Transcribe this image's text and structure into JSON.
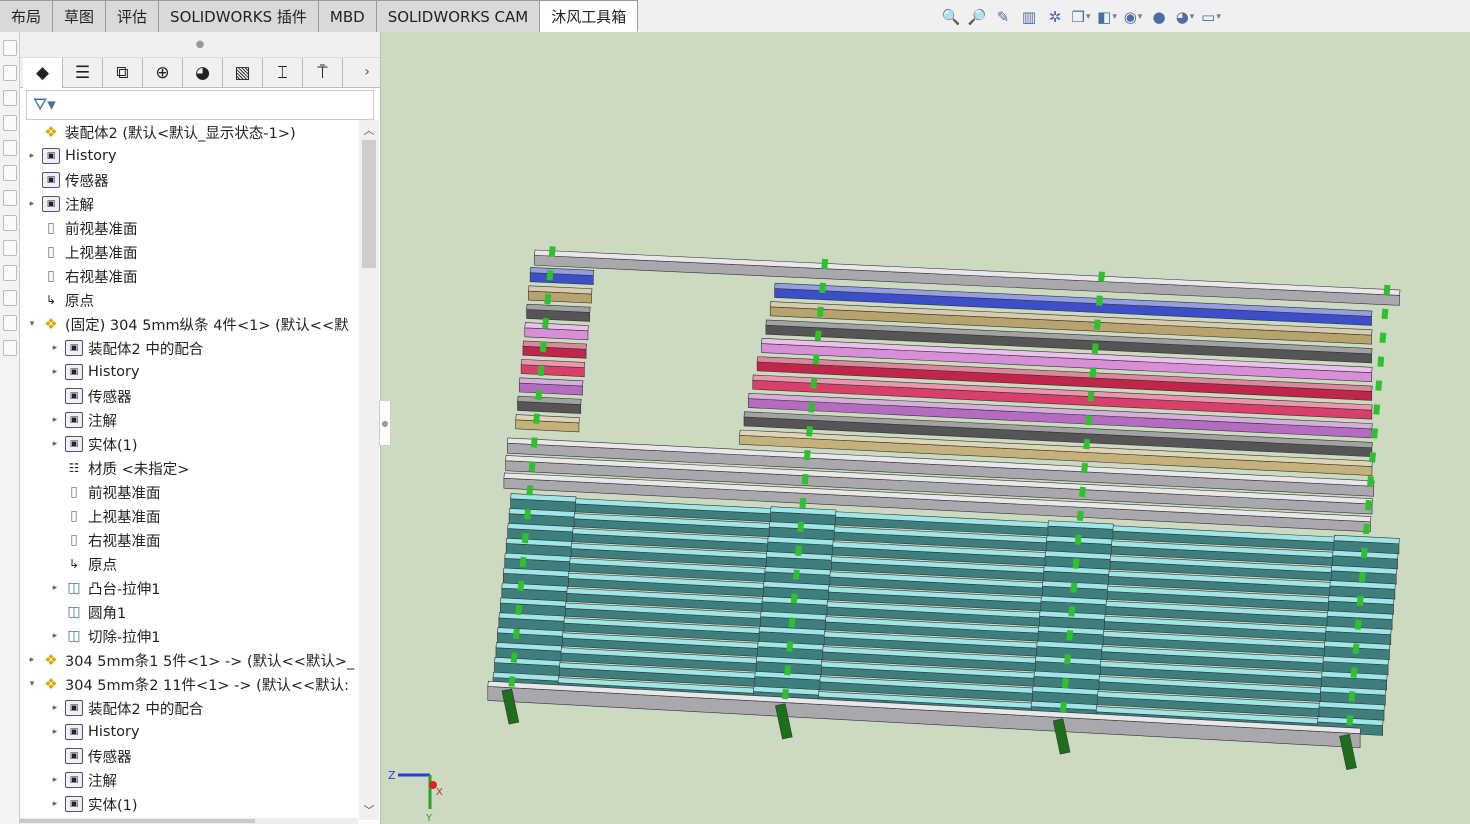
{
  "tabs": [
    {
      "label": "布局"
    },
    {
      "label": "草图"
    },
    {
      "label": "评估"
    },
    {
      "label": "SOLIDWORKS 插件"
    },
    {
      "label": "MBD"
    },
    {
      "label": "SOLIDWORKS CAM"
    },
    {
      "label": "沐风工具箱",
      "active": true
    }
  ],
  "view_tools": [
    {
      "icon": "zoom-to-fit-icon",
      "g": "🔍"
    },
    {
      "icon": "zoom-area-icon",
      "g": "🔎"
    },
    {
      "icon": "previous-view-icon",
      "g": "✎"
    },
    {
      "icon": "section-view-icon",
      "g": "▥"
    },
    {
      "icon": "dynamic-annotation-icon",
      "g": "✲"
    },
    {
      "icon": "view-orientation-icon",
      "g": "❒",
      "dd": true
    },
    {
      "icon": "display-style-icon",
      "g": "◧",
      "dd": true
    },
    {
      "icon": "hide-show-icon",
      "g": "◉",
      "dd": true
    },
    {
      "icon": "edit-appearance-icon",
      "g": "●"
    },
    {
      "icon": "apply-scene-icon",
      "g": "◕",
      "dd": true
    },
    {
      "icon": "view-settings-icon",
      "g": "▭",
      "dd": true
    }
  ],
  "panel_tabs": [
    {
      "icon": "featuremanager-icon",
      "g": "◆",
      "active": true
    },
    {
      "icon": "propertymanager-icon",
      "g": "☰"
    },
    {
      "icon": "configurationmanager-icon",
      "g": "⧉"
    },
    {
      "icon": "dimxpertmanager-icon",
      "g": "⊕"
    },
    {
      "icon": "displaymanager-icon",
      "g": "◕"
    },
    {
      "icon": "cam-feature-tree-icon",
      "g": "▧"
    },
    {
      "icon": "cam-operation-tree-icon",
      "g": "⌶"
    },
    {
      "icon": "cam-tool-tree-icon",
      "g": "⍑"
    }
  ],
  "tree": [
    {
      "label": "装配体2  (默认<默认_显示状态-1>)",
      "level": 0,
      "exp": "",
      "icon": "asm"
    },
    {
      "label": "History",
      "level": 0,
      "exp": "▸",
      "icon": "fold"
    },
    {
      "label": "传感器",
      "level": 0,
      "exp": "",
      "icon": "fold"
    },
    {
      "label": "注解",
      "level": 0,
      "exp": "▸",
      "icon": "fold"
    },
    {
      "label": "前视基准面",
      "level": 0,
      "exp": "",
      "icon": "plane"
    },
    {
      "label": "上视基准面",
      "level": 0,
      "exp": "",
      "icon": "plane"
    },
    {
      "label": "右视基准面",
      "level": 0,
      "exp": "",
      "icon": "plane"
    },
    {
      "label": "原点",
      "level": 0,
      "exp": "",
      "icon": "origin"
    },
    {
      "label": "(固定) 304  5mm纵条   4件<1> (默认<<默",
      "level": 0,
      "exp": "▾",
      "icon": "asm"
    },
    {
      "label": "装配体2 中的配合",
      "level": 1,
      "exp": "▸",
      "icon": "fold"
    },
    {
      "label": "History",
      "level": 1,
      "exp": "▸",
      "icon": "fold"
    },
    {
      "label": "传感器",
      "level": 1,
      "exp": "",
      "icon": "fold"
    },
    {
      "label": "注解",
      "level": 1,
      "exp": "▸",
      "icon": "fold"
    },
    {
      "label": "实体(1)",
      "level": 1,
      "exp": "▸",
      "icon": "fold"
    },
    {
      "label": "材质 <未指定>",
      "level": 1,
      "exp": "",
      "icon": "material"
    },
    {
      "label": "前视基准面",
      "level": 1,
      "exp": "",
      "icon": "plane"
    },
    {
      "label": "上视基准面",
      "level": 1,
      "exp": "",
      "icon": "plane"
    },
    {
      "label": "右视基准面",
      "level": 1,
      "exp": "",
      "icon": "plane"
    },
    {
      "label": "原点",
      "level": 1,
      "exp": "",
      "icon": "origin"
    },
    {
      "label": "凸台-拉伸1",
      "level": 1,
      "exp": "▸",
      "icon": "feat"
    },
    {
      "label": "圆角1",
      "level": 1,
      "exp": "",
      "icon": "feat"
    },
    {
      "label": "切除-拉伸1",
      "level": 1,
      "exp": "▸",
      "icon": "feat"
    },
    {
      "label": "304  5mm条1  5件<1> -> (默认<<默认>_",
      "level": 0,
      "exp": "▸",
      "icon": "asm"
    },
    {
      "label": "304  5mm条2   11件<1> -> (默认<<默认:",
      "level": 0,
      "exp": "▾",
      "icon": "asm"
    },
    {
      "label": "装配体2 中的配合",
      "level": 1,
      "exp": "▸",
      "icon": "fold"
    },
    {
      "label": "History",
      "level": 1,
      "exp": "▸",
      "icon": "fold"
    },
    {
      "label": "传感器",
      "level": 1,
      "exp": "",
      "icon": "fold"
    },
    {
      "label": "注解",
      "level": 1,
      "exp": "▸",
      "icon": "fold"
    },
    {
      "label": "实体(1)",
      "level": 1,
      "exp": "▸",
      "icon": "fold"
    }
  ],
  "icons": {
    "asm": "❖",
    "fold": "▣",
    "plane": "▯",
    "origin": "↳",
    "feat": "◫",
    "material": "☷"
  },
  "colors": {
    "viewport_bg": "#cbdac0",
    "bar_gray": "#a9a8ac",
    "bar_teal": "#3e7f7d",
    "bar_teal_top": "#9fe6e8",
    "post_green": "#2fbf2f",
    "colored_bars": [
      "#3c4fc8",
      "#b8a36c",
      "#555555",
      "#d98fd8",
      "#c0254a",
      "#d8406a",
      "#b56cc0",
      "#555555",
      "#c4b27a"
    ]
  },
  "triad": {
    "x": "X",
    "y": "Y",
    "z": "Z"
  }
}
